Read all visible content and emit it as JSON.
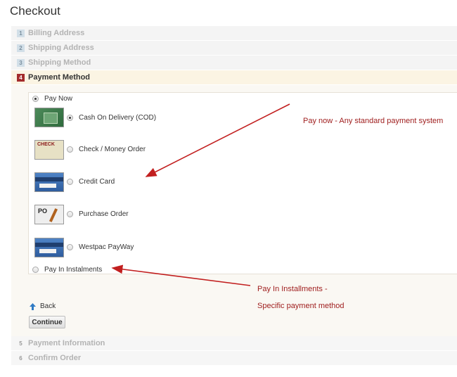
{
  "page": {
    "title": "Checkout"
  },
  "steps_top": [
    {
      "num": "1",
      "label": "Billing Address"
    },
    {
      "num": "2",
      "label": "Shipping Address"
    },
    {
      "num": "3",
      "label": "Shipping Method"
    },
    {
      "num": "4",
      "label": "Payment Method"
    }
  ],
  "steps_bottom": [
    {
      "num": "5",
      "label": "Payment Information"
    },
    {
      "num": "6",
      "label": "Confirm Order"
    }
  ],
  "payment": {
    "pay_now": "Pay Now",
    "options": [
      {
        "label": "Cash On Delivery (COD)",
        "icon": "cod-card-icon",
        "selected": true
      },
      {
        "label": "Check / Money Order",
        "icon": "check-icon",
        "selected": false
      },
      {
        "label": "Credit Card",
        "icon": "credit-card-icon",
        "selected": false
      },
      {
        "label": "Purchase Order",
        "icon": "purchase-order-icon",
        "selected": false
      },
      {
        "label": "Westpac PayWay",
        "icon": "westpac-card-icon",
        "selected": false
      }
    ],
    "instalments": "Pay In Instalments"
  },
  "icon_text": {
    "check": "CHECK",
    "po": "PO"
  },
  "annotations": {
    "pay_now": "Pay now - Any standard payment system",
    "instalments_1": "Pay In Installments -",
    "instalments_2": "Specific payment method"
  },
  "actions": {
    "back": "Back",
    "continue": "Continue"
  },
  "colors": {
    "active_step": "#a32b2b",
    "annotation": "#a02020",
    "step_bg": "#f4f4f4"
  }
}
